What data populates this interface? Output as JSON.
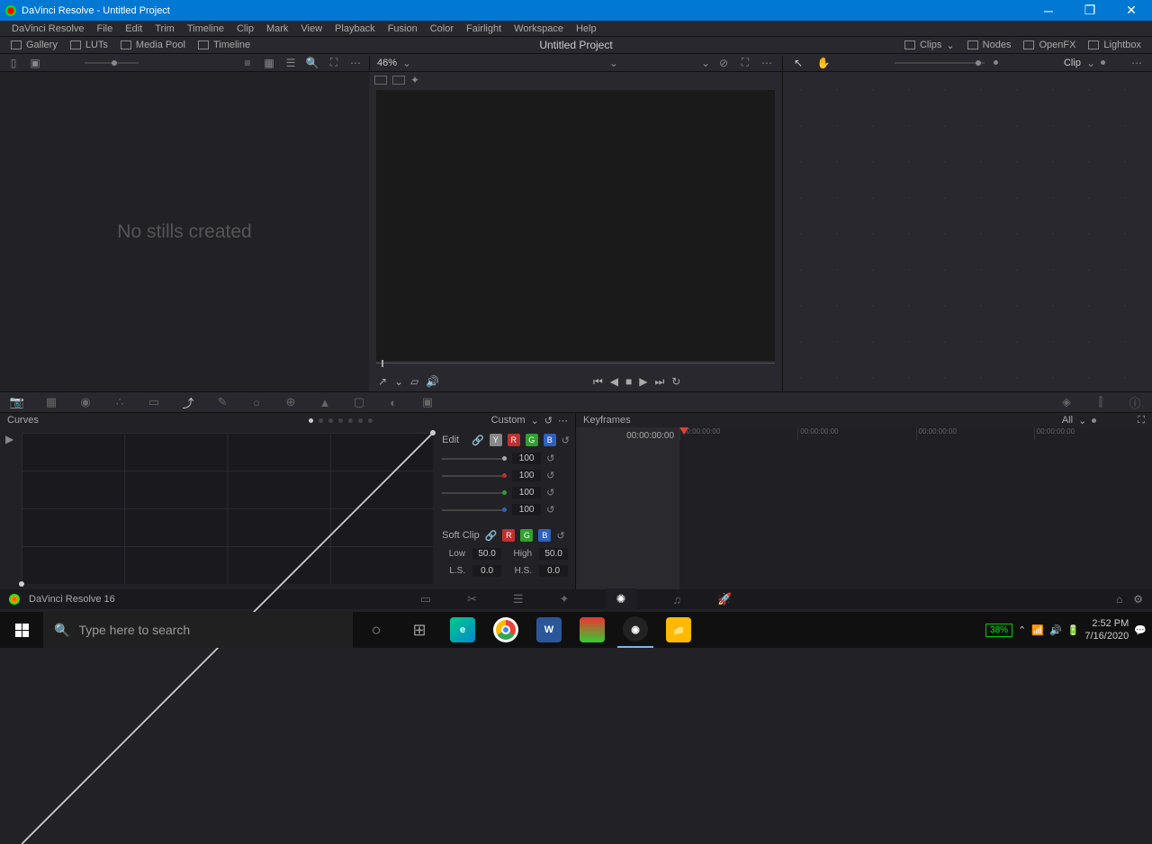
{
  "titlebar": {
    "title": "DaVinci Resolve - Untitled Project"
  },
  "menu": [
    "DaVinci Resolve",
    "File",
    "Edit",
    "Trim",
    "Timeline",
    "Clip",
    "Mark",
    "View",
    "Playback",
    "Fusion",
    "Color",
    "Fairlight",
    "Workspace",
    "Help"
  ],
  "toolbar": {
    "left": [
      "Gallery",
      "LUTs",
      "Media Pool",
      "Timeline"
    ],
    "center": "Untitled Project",
    "right": [
      "Clips",
      "Nodes",
      "OpenFX",
      "Lightbox"
    ]
  },
  "viewer": {
    "zoom": "46%",
    "node_mode": "Clip"
  },
  "gallery": {
    "empty_text": "No stills created"
  },
  "curves": {
    "title": "Curves",
    "mode": "Custom",
    "edit_label": "Edit",
    "softclip_label": "Soft Clip",
    "channels": [
      {
        "color": "#aaa",
        "value": "100"
      },
      {
        "color": "#c03030",
        "value": "100"
      },
      {
        "color": "#30a030",
        "value": "100"
      },
      {
        "color": "#3060c0",
        "value": "100"
      }
    ],
    "low_label": "Low",
    "low_val": "50.0",
    "high_label": "High",
    "high_val": "50.0",
    "ls_label": "L.S.",
    "ls_val": "0.0",
    "hs_label": "H.S.",
    "hs_val": "0.0"
  },
  "keyframes": {
    "title": "Keyframes",
    "filter": "All",
    "timecode": "00:00:00:00",
    "ruler_tc": "00:00:00:00"
  },
  "pagenav": {
    "version": "DaVinci Resolve 16"
  },
  "taskbar": {
    "search_placeholder": "Type here to search",
    "battery": "38%",
    "time": "2:52 PM",
    "date": "7/16/2020"
  }
}
